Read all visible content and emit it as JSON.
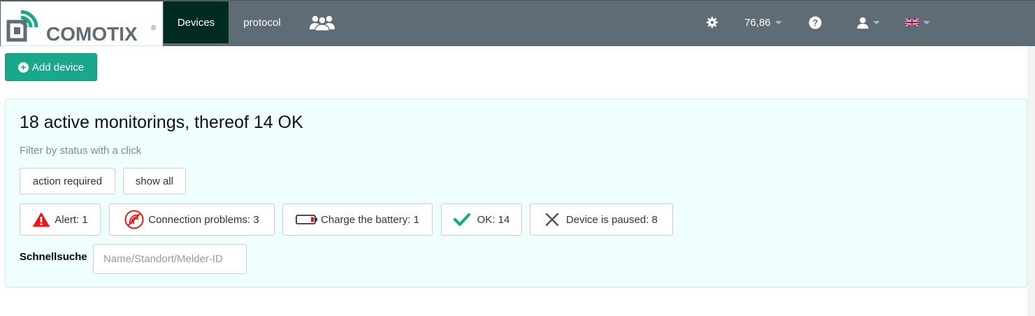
{
  "brand": {
    "logo_text": "COMOTIX",
    "registered_mark": "®",
    "logo_color": "#1aa88a"
  },
  "nav": {
    "items": [
      {
        "label": "Devices",
        "active": true
      },
      {
        "label": "protocol",
        "active": false
      }
    ],
    "groups_icon": "users-icon",
    "settings_icon": "gear-icon",
    "account_value": "76,86",
    "help_icon": "question-circle-icon",
    "user_icon": "user-icon",
    "language_icon": "uk-flag-icon"
  },
  "toolbar": {
    "add_device_label": "Add device",
    "add_icon": "plus-circle-icon"
  },
  "panel": {
    "title": "18 active monitorings, thereof 14 OK",
    "hint": "Filter by status with a click",
    "filters": [
      {
        "label": "action required"
      },
      {
        "label": "show all"
      }
    ],
    "status_buttons": [
      {
        "label": "Alert: 1",
        "icon": "warning-triangle-icon",
        "color": "#e31a1a"
      },
      {
        "label": "Connection problems: 3",
        "icon": "no-signal-icon",
        "color": "#e31a1a"
      },
      {
        "label": "Charge the battery: 1",
        "icon": "low-battery-icon",
        "color": "#e31a1a"
      },
      {
        "label": "OK: 14",
        "icon": "checkmark-icon",
        "color": "#1aa88a"
      },
      {
        "label": "Device is paused: 8",
        "icon": "x-icon",
        "color": "#555555"
      }
    ],
    "search": {
      "label": "Schnellsuche",
      "placeholder": "Name/Standort/Melder-ID"
    }
  },
  "colors": {
    "navbar": "#5f6b75",
    "active_nav": "#002a1f",
    "accent": "#1aa88a",
    "panel_bg": "#eefffd"
  }
}
